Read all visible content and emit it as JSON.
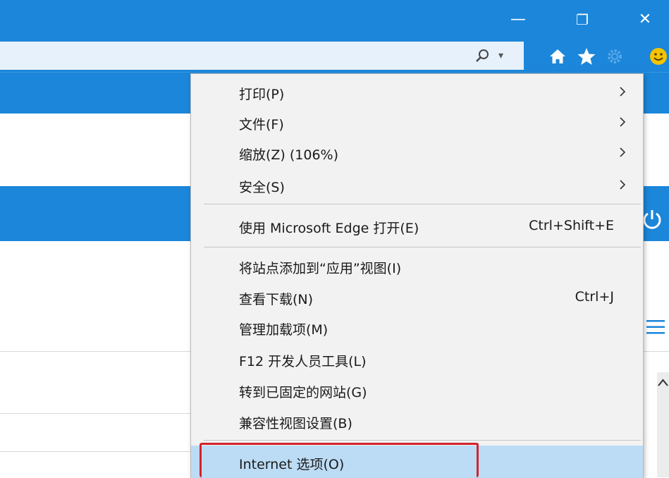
{
  "window": {
    "minimize_glyph": "—",
    "restore_glyph": "❐",
    "close_glyph": "✕"
  },
  "toolbar": {
    "icons": [
      "search-icon",
      "dropdown-arrow-icon",
      "home-icon",
      "favorites-star-icon",
      "gear-icon",
      "smiley-feedback-icon"
    ]
  },
  "colors": {
    "titlebar": "#1b86da",
    "menu_background": "#f2f2f2",
    "menu_highlight": "#bcdcf5",
    "highlight_border": "#d2232a"
  },
  "menu": {
    "items": [
      {
        "label": "打印(P)",
        "submenu": true
      },
      {
        "label": "文件(F)",
        "submenu": true
      },
      {
        "label": "缩放(Z) (106%)",
        "submenu": true
      },
      {
        "label": "安全(S)",
        "submenu": true
      },
      {
        "label": "使用 Microsoft Edge 打开(E)",
        "shortcut": "Ctrl+Shift+E"
      },
      {
        "label": "将站点添加到“应用”视图(I)"
      },
      {
        "label": "查看下载(N)",
        "shortcut": "Ctrl+J"
      },
      {
        "label": "管理加载项(M)"
      },
      {
        "label": "F12 开发人员工具(L)"
      },
      {
        "label": "转到已固定的网站(G)"
      },
      {
        "label": "兼容性视图设置(B)"
      },
      {
        "label": "Internet 选项(O)",
        "highlighted": true
      }
    ]
  }
}
